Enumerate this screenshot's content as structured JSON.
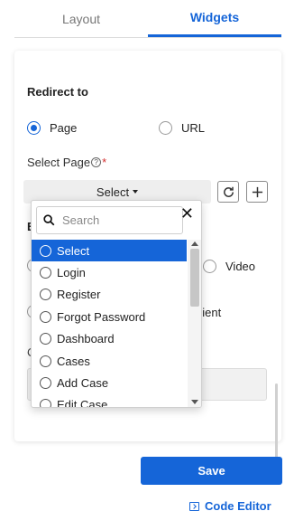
{
  "tabs": [
    {
      "label": "Layout",
      "active": false
    },
    {
      "label": "Widgets",
      "active": true
    }
  ],
  "redirect": {
    "title": "Redirect to",
    "options": [
      {
        "label": "Page",
        "checked": true
      },
      {
        "label": "URL",
        "checked": false
      }
    ],
    "select_label": "Select Page",
    "help_glyph": "?",
    "required_mark": "*",
    "select_value": "Select"
  },
  "dropdown": {
    "search_placeholder": "Search",
    "items": [
      "Select",
      "Login",
      "Register",
      "Forgot Password",
      "Dashboard",
      "Cases",
      "Add Case",
      "Edit Case"
    ],
    "selected_index": 0
  },
  "background_fragments": {
    "section_letter": "E",
    "video_label": "Video",
    "gradient_label": "dient",
    "c_letter": "C"
  },
  "footer": {
    "save_label": "Save",
    "code_editor_label": "Code Editor"
  },
  "colors": {
    "accent": "#1565d8",
    "required": "#d32f2f"
  },
  "icons": {
    "refresh": "refresh-icon",
    "add": "plus-icon",
    "search": "search-icon",
    "clear": "close-icon",
    "code": "code-editor-icon"
  }
}
